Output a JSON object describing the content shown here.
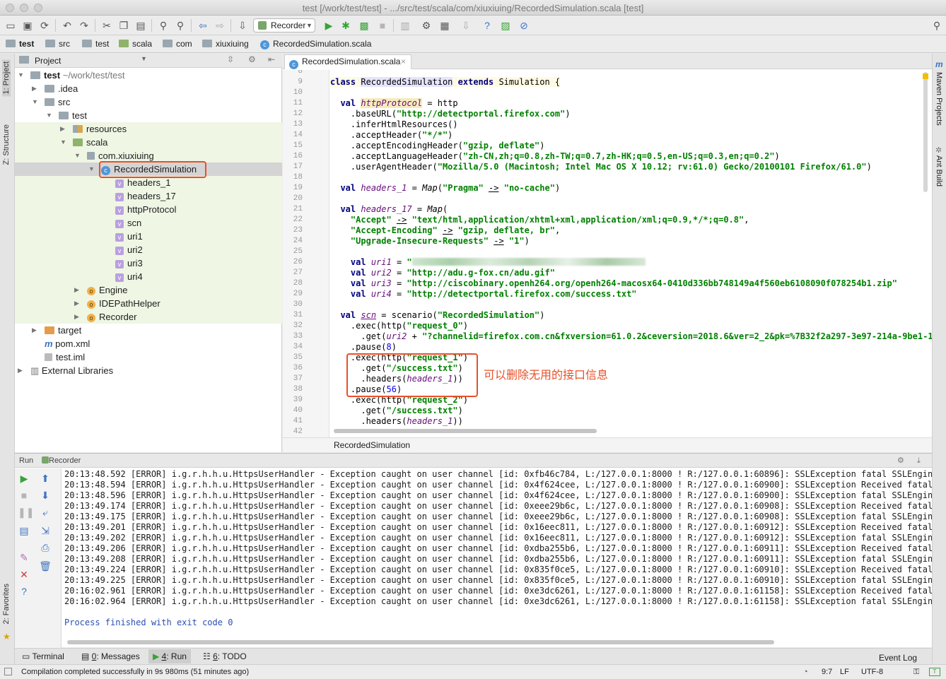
{
  "window": {
    "title": "test [/work/test/test] - .../src/test/scala/com/xiuxiuing/RecordedSimulation.scala [test]"
  },
  "toolbar": {
    "run_config": "Recorder"
  },
  "breadcrumbs": [
    "test",
    "src",
    "test",
    "scala",
    "com",
    "xiuxiuing",
    "RecordedSimulation.scala"
  ],
  "left_strip": {
    "project_tab": "1: Project",
    "structure_tab": "Z: Structure",
    "favorites_tab": "2: Favorites"
  },
  "right_strip": {
    "maven_tab": "Maven Projects",
    "ant_tab": "Ant Build"
  },
  "project": {
    "header": "Project",
    "tree": [
      {
        "label": "test",
        "extra": "~/work/test/test",
        "level": 0,
        "kind": "folder",
        "open": true
      },
      {
        "label": ".idea",
        "level": 1,
        "kind": "folder"
      },
      {
        "label": "src",
        "level": 1,
        "kind": "folder",
        "open": true
      },
      {
        "label": "test",
        "level": 2,
        "kind": "folder",
        "open": true
      },
      {
        "label": "resources",
        "level": 3,
        "kind": "resources"
      },
      {
        "label": "scala",
        "level": 3,
        "kind": "folder-green",
        "open": true
      },
      {
        "label": "com.xiuxiuing",
        "level": 4,
        "kind": "package",
        "open": true
      },
      {
        "label": "RecordedSimulation",
        "level": 5,
        "kind": "class",
        "open": true,
        "selected": true
      },
      {
        "label": "headers_1",
        "level": 6,
        "kind": "val"
      },
      {
        "label": "headers_17",
        "level": 6,
        "kind": "val"
      },
      {
        "label": "httpProtocol",
        "level": 6,
        "kind": "val"
      },
      {
        "label": "scn",
        "level": 6,
        "kind": "val"
      },
      {
        "label": "uri1",
        "level": 6,
        "kind": "val"
      },
      {
        "label": "uri2",
        "level": 6,
        "kind": "val"
      },
      {
        "label": "uri3",
        "level": 6,
        "kind": "val"
      },
      {
        "label": "uri4",
        "level": 6,
        "kind": "val"
      },
      {
        "label": "Engine",
        "level": 4,
        "kind": "object"
      },
      {
        "label": "IDEPathHelper",
        "level": 4,
        "kind": "object"
      },
      {
        "label": "Recorder",
        "level": 4,
        "kind": "object"
      },
      {
        "label": "target",
        "level": 1,
        "kind": "folder-orange"
      },
      {
        "label": "pom.xml",
        "level": 1,
        "kind": "maven"
      },
      {
        "label": "test.iml",
        "level": 1,
        "kind": "file"
      },
      {
        "label": "External Libraries",
        "level": 0,
        "kind": "libs"
      }
    ]
  },
  "editor": {
    "tab": "RecordedSimulation.scala",
    "footer": "RecordedSimulation",
    "first_line_number": 8,
    "annotation": "可以删除无用的接口信息"
  },
  "run": {
    "header_run": "Run",
    "header_name": "Recorder",
    "log_rows": [
      {
        "time": "20:13:48.592",
        "id": "0xfb46c784",
        "remote": "60896",
        "tail": "SSLException fatal SSLEngine con"
      },
      {
        "time": "20:13:48.594",
        "id": "0x4f624cee",
        "remote": "60900",
        "tail": "SSLException Received fatal aler"
      },
      {
        "time": "20:13:48.596",
        "id": "0x4f624cee",
        "remote": "60900",
        "tail": "SSLException fatal SSLEngine con"
      },
      {
        "time": "20:13:49.174",
        "id": "0xeee29b6c",
        "remote": "60908",
        "tail": "SSLException Received fatal aler"
      },
      {
        "time": "20:13:49.175",
        "id": "0xeee29b6c",
        "remote": "60908",
        "tail": "SSLException fatal SSLEngine con"
      },
      {
        "time": "20:13:49.201",
        "id": "0x16eec811",
        "remote": "60912",
        "tail": "SSLException Received fatal aler"
      },
      {
        "time": "20:13:49.202",
        "id": "0x16eec811",
        "remote": "60912",
        "tail": "SSLException fatal SSLEngine con"
      },
      {
        "time": "20:13:49.206",
        "id": "0xdba255b6",
        "remote": "60911",
        "tail": "SSLException Received fatal aler"
      },
      {
        "time": "20:13:49.208",
        "id": "0xdba255b6",
        "remote": "60911",
        "tail": "SSLException fatal SSLEngine con"
      },
      {
        "time": "20:13:49.224",
        "id": "0x835f0ce5",
        "remote": "60910",
        "tail": "SSLException Received fatal aler"
      },
      {
        "time": "20:13:49.225",
        "id": "0x835f0ce5",
        "remote": "60910",
        "tail": "SSLException fatal SSLEngine con"
      },
      {
        "time": "20:16:02.961",
        "id": "0xe3dc6261",
        "remote": "61158",
        "tail": "SSLException Received fatal aler"
      },
      {
        "time": "20:16:02.964",
        "id": "0xe3dc6261",
        "remote": "61158",
        "tail": "SSLException fatal SSLEngine con"
      }
    ],
    "log_level": "[ERROR]",
    "log_source": "i.g.r.h.h.u.HttpsUserHandler",
    "log_message": "Exception caught on user channel",
    "log_local": "L:/127.0.0.1:8000",
    "process_finished": "Process finished with exit code 0"
  },
  "bottom_tabs": {
    "terminal": "Terminal",
    "messages_num": "0",
    "messages": ": Messages",
    "run_num": "4",
    "run": ": Run",
    "todo_num": "6",
    "todo": ": TODO",
    "event_log": "Event Log"
  },
  "status": {
    "message": "Compilation completed successfully in 9s 980ms (51 minutes ago)",
    "position": "9:7",
    "line_sep": "LF",
    "encoding": "UTF-8"
  }
}
